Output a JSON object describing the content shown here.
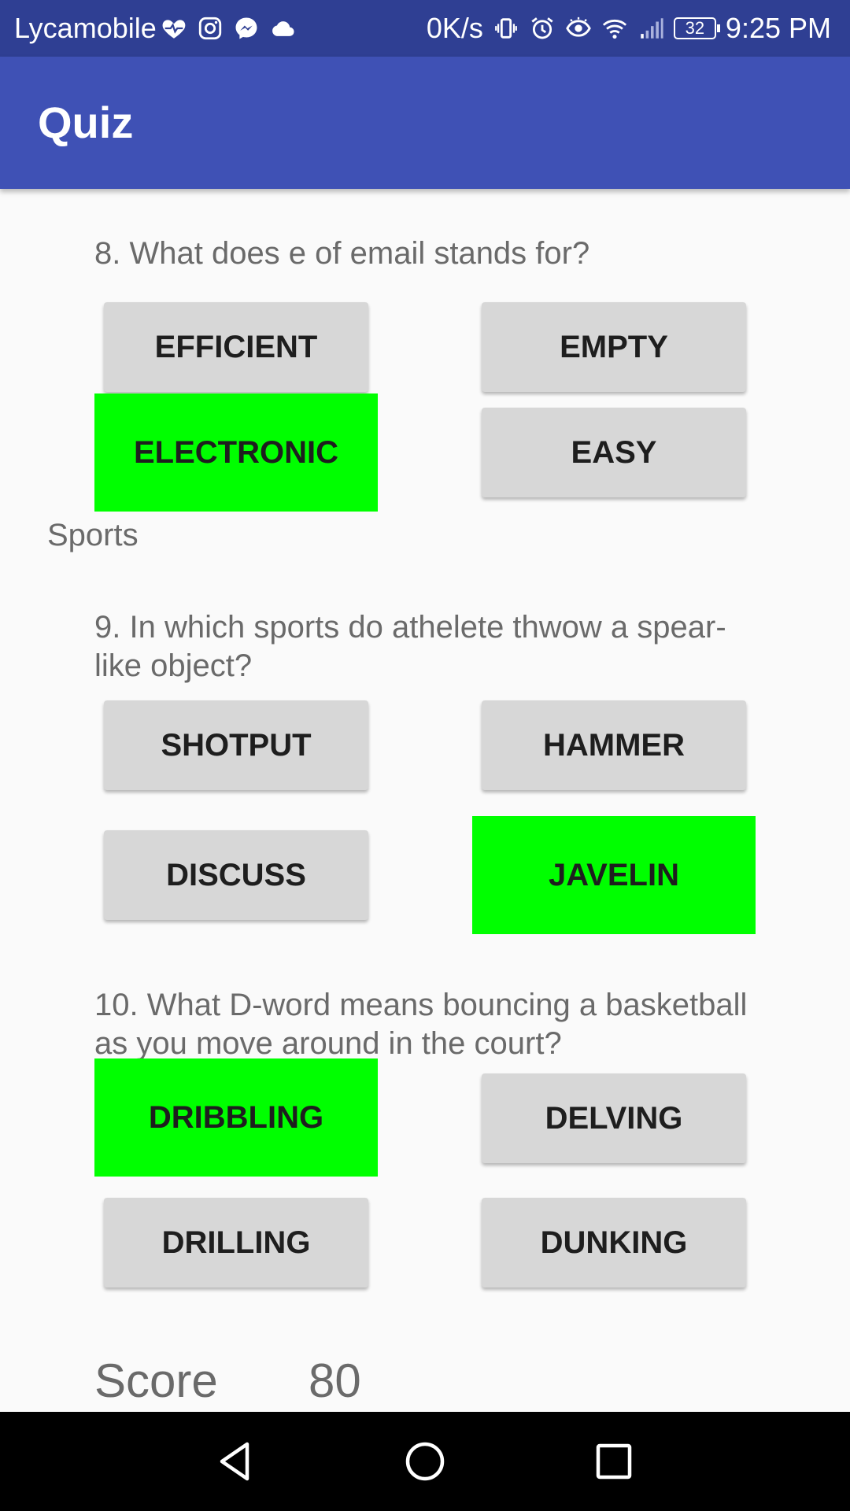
{
  "status_bar": {
    "carrier": "Lycamobile",
    "speed": "0K/s",
    "battery": "32",
    "time": "9:25 PM",
    "icons": [
      "heart-pulse-icon",
      "instagram-icon",
      "messenger-icon",
      "cloud-icon",
      "vibrate-icon",
      "alarm-icon",
      "eye-icon",
      "wifi-icon",
      "signal-icon",
      "battery-icon"
    ]
  },
  "app_bar": {
    "title": "Quiz",
    "color": "#3f51b5"
  },
  "questions": [
    {
      "text": "8. What does e of email stands for?",
      "options": [
        "EFFICIENT",
        "EMPTY",
        "ELECTRONIC",
        "EASY"
      ],
      "selected": "ELECTRONIC"
    },
    {
      "section": "Sports",
      "text": "9. In which sports do athelete thwow a spear-like object?",
      "options": [
        "SHOTPUT",
        "HAMMER",
        "DISCUSS",
        "JAVELIN"
      ],
      "selected": "JAVELIN"
    },
    {
      "text": "10. What D-word means bouncing a basketball as you move around in the court?",
      "options": [
        "DRIBBLING",
        "DELVING",
        "DRILLING",
        "DUNKING"
      ],
      "selected": "DRIBBLING"
    }
  ],
  "score": {
    "label": "Score",
    "value": "80"
  },
  "colors": {
    "selected_answer": "#00ff00",
    "button": "#d7d7d7",
    "status_bar": "#2f3f93"
  },
  "nav_bar": {
    "icons": [
      "back-icon",
      "home-icon",
      "recents-icon"
    ]
  }
}
